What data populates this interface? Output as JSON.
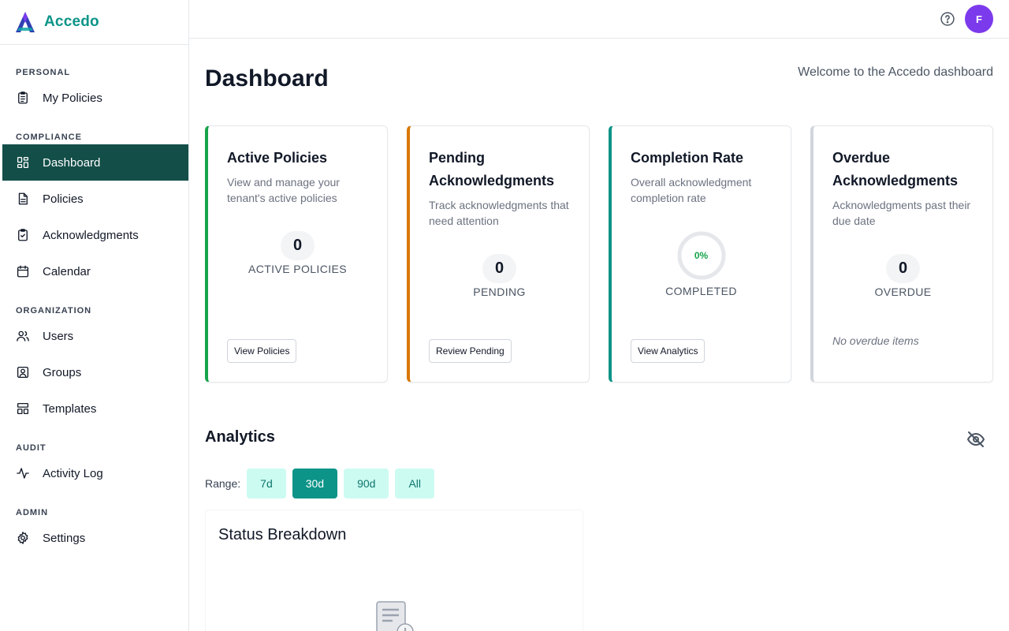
{
  "app": {
    "name": "Accedo"
  },
  "sidebar": {
    "sections": [
      {
        "label": "PERSONAL",
        "items": [
          {
            "label": "My Policies",
            "icon": "clipboard-list-icon"
          }
        ]
      },
      {
        "label": "COMPLIANCE",
        "items": [
          {
            "label": "Dashboard",
            "icon": "dashboard-grid-icon",
            "active": true
          },
          {
            "label": "Policies",
            "icon": "document-icon"
          },
          {
            "label": "Acknowledgments",
            "icon": "clipboard-check-icon"
          },
          {
            "label": "Calendar",
            "icon": "calendar-icon"
          }
        ]
      },
      {
        "label": "ORGANIZATION",
        "items": [
          {
            "label": "Users",
            "icon": "users-icon"
          },
          {
            "label": "Groups",
            "icon": "group-icon"
          },
          {
            "label": "Templates",
            "icon": "templates-icon"
          }
        ]
      },
      {
        "label": "AUDIT",
        "items": [
          {
            "label": "Activity Log",
            "icon": "activity-icon"
          }
        ]
      },
      {
        "label": "ADMIN",
        "items": [
          {
            "label": "Settings",
            "icon": "gear-icon"
          }
        ]
      }
    ]
  },
  "topbar": {
    "avatar_initial": "F",
    "avatar_color": "#7c3aed",
    "help_icon": "help-circle-icon"
  },
  "page": {
    "title": "Dashboard",
    "welcome": "Welcome to the Accedo dashboard"
  },
  "cards": [
    {
      "title": "Active Policies",
      "description": "View and manage your tenant's active policies",
      "value": "0",
      "metric_label": "ACTIVE POLICIES",
      "button": "View Policies",
      "accent": "#16a34a"
    },
    {
      "title": "Pending Acknowledgments",
      "description": "Track acknowledgments that need attention",
      "value": "0",
      "metric_label": "PENDING",
      "button": "Review Pending",
      "accent": "#d97706"
    },
    {
      "title": "Completion Rate",
      "description": "Overall acknowledgment completion rate",
      "value": "0%",
      "metric_label": "COMPLETED",
      "button": "View Analytics",
      "accent": "#0d9488",
      "progress": 0
    },
    {
      "title": "Overdue Acknowledgments",
      "description": "Acknowledgments past their due date",
      "value": "0",
      "metric_label": "OVERDUE",
      "note": "No overdue items",
      "accent": "#d1d5db"
    }
  ],
  "analytics": {
    "title": "Analytics",
    "range_label": "Range:",
    "ranges": [
      "7d",
      "30d",
      "90d",
      "All"
    ],
    "selected_range": "30d",
    "panel_title": "Status Breakdown"
  },
  "colors": {
    "brand": "#0d9488",
    "sidebar_active_bg": "#134e48"
  }
}
